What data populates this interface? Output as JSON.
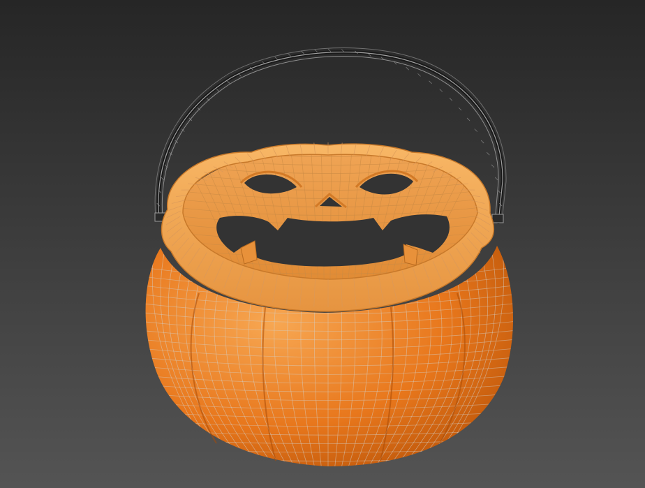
{
  "viewport": {
    "background_top": "#262626",
    "background_bottom": "#545454"
  },
  "model": {
    "object_name": "pumpkin-bucket",
    "shading": "smooth-with-wireframe",
    "body_color_light": "#f7a752",
    "body_color_mid": "#e8771c",
    "body_color_dark": "#b24e05",
    "inner_color": "#f5a24c",
    "rim_color": "#f3a950",
    "wire_color": "#d4cfc8",
    "handle_wire_color": "#9a9a9a",
    "handle_dark_color": "#1a1a1a"
  }
}
